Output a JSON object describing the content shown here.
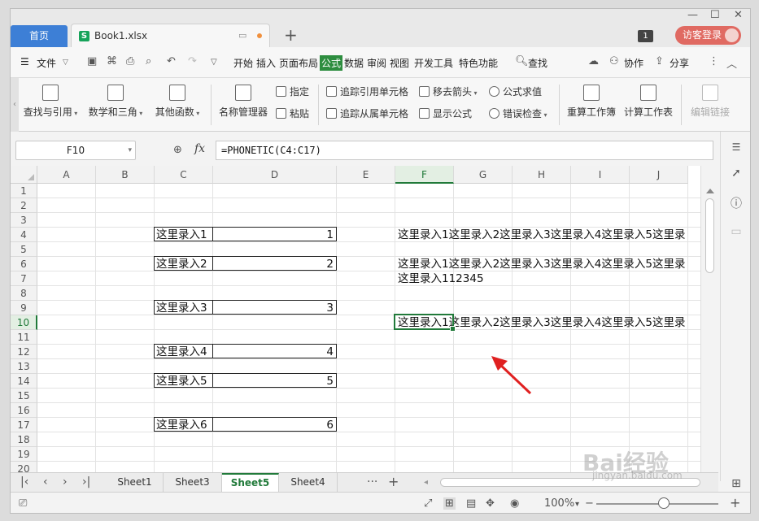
{
  "titlebar": {
    "home_tab": "首页",
    "doc_tab": "Book1.xlsx",
    "window_count": "1",
    "visitor_login": "访客登录"
  },
  "menu": {
    "file": "文件",
    "items": [
      "开始",
      "插入",
      "页面布局",
      "公式",
      "数据",
      "审阅",
      "视图",
      "开发工具",
      "特色功能"
    ],
    "active": "公式",
    "search": "查找",
    "collab": "协作",
    "share": "分享"
  },
  "ribbon": {
    "big": [
      {
        "label": "查找与引用",
        "dropdown": true
      },
      {
        "label": "数学和三角",
        "dropdown": true
      },
      {
        "label": "其他函数",
        "dropdown": true
      },
      {
        "label": "名称管理器"
      }
    ],
    "small": {
      "assign": "指定",
      "paste": "粘贴",
      "trace_precedents": "追踪引用单元格",
      "trace_dependents": "追踪从属单元格",
      "remove_arrows": "移去箭头",
      "show_formulas": "显示公式",
      "evaluate": "公式求值",
      "error_check": "错误检查"
    },
    "big2": [
      {
        "label": "重算工作簿"
      },
      {
        "label": "计算工作表"
      },
      {
        "label": "编辑链接",
        "disabled": true
      }
    ]
  },
  "formula_bar": {
    "name_box": "F10",
    "fx": "fx",
    "formula": "=PHONETIC(C4:C17)"
  },
  "grid": {
    "columns": [
      "A",
      "B",
      "C",
      "D",
      "E",
      "F",
      "G",
      "H",
      "I",
      "J"
    ],
    "selected_column": "F",
    "rows": [
      "1",
      "2",
      "3",
      "4",
      "5",
      "6",
      "7",
      "8",
      "9",
      "10",
      "11",
      "12",
      "13",
      "14",
      "15",
      "16",
      "17",
      "18",
      "19",
      "20"
    ],
    "selected_row": "10",
    "table": [
      {
        "row": "4",
        "label": "这里录入1",
        "value": "1"
      },
      {
        "row": "6",
        "label": "这里录入2",
        "value": "2"
      },
      {
        "row": "9",
        "label": "这里录入3",
        "value": "3"
      },
      {
        "row": "12",
        "label": "这里录入4",
        "value": "4"
      },
      {
        "row": "14",
        "label": "这里录入5",
        "value": "5"
      },
      {
        "row": "17",
        "label": "这里录入6",
        "value": "6"
      }
    ],
    "results": [
      {
        "row": "4",
        "text": "这里录入1这里录入2这里录入3这里录入4这里录入5这里录"
      },
      {
        "row": "6",
        "text": "这里录入1这里录入2这里录入3这里录入4这里录入5这里录"
      },
      {
        "row": "7",
        "text": "这里录入112345"
      },
      {
        "row": "10",
        "text": "这里录入1这里录入2这里录入3这里录入4这里录入5这里录"
      }
    ]
  },
  "sheets": {
    "tabs": [
      "Sheet1",
      "Sheet3",
      "Sheet5",
      "Sheet4"
    ],
    "active": "Sheet5",
    "more": "···",
    "add": "+"
  },
  "status": {
    "zoom": "100%",
    "zoom_out": "−",
    "zoom_in": "+"
  },
  "watermark": {
    "brand": "Bai经验",
    "url": "jingyan.baidu.com"
  },
  "colors": {
    "accent": "#217a3a",
    "home_tab": "#3d7fd6",
    "visitor": "#e06a62",
    "annotation_arrow": "#e02020"
  }
}
